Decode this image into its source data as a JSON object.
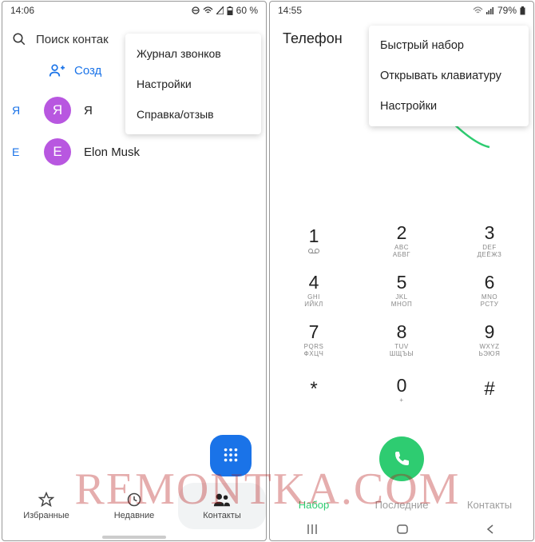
{
  "left": {
    "status": {
      "time": "14:06",
      "battery": "60 %"
    },
    "search_placeholder": "Поиск контак",
    "menu": {
      "item1": "Журнал звонков",
      "item2": "Настройки",
      "item3": "Справка/отзыв"
    },
    "create_label": "Созд",
    "contacts": [
      {
        "letter": "Я",
        "initial": "Я",
        "name": "Я",
        "color": "#b857e0"
      },
      {
        "letter": "E",
        "initial": "E",
        "name": "Elon Musk",
        "color": "#b857e0"
      }
    ],
    "bottom": {
      "fav": "Избранные",
      "recent": "Недавние",
      "contacts": "Контакты"
    }
  },
  "right": {
    "status": {
      "time": "14:55",
      "battery": "79%"
    },
    "header": "Телефон",
    "menu": {
      "item1": "Быстрый набор",
      "item2": "Открывать клавиатуру",
      "item3": "Настройки"
    },
    "keys": [
      {
        "n": "1",
        "s": ""
      },
      {
        "n": "2",
        "s": "ABC\nАБВГ"
      },
      {
        "n": "3",
        "s": "DEF\nДЕЁЖЗ"
      },
      {
        "n": "4",
        "s": "GHI\nИЙКЛ"
      },
      {
        "n": "5",
        "s": "JKL\nМНОП"
      },
      {
        "n": "6",
        "s": "MNO\nРСТУ"
      },
      {
        "n": "7",
        "s": "PQRS\nФХЦЧ"
      },
      {
        "n": "8",
        "s": "TUV\nШЩЪЫ"
      },
      {
        "n": "9",
        "s": "WXYZ\nЬЭЮЯ"
      },
      {
        "n": "*",
        "s": ""
      },
      {
        "n": "0",
        "s": "+"
      },
      {
        "n": "#",
        "s": ""
      }
    ],
    "bottom": {
      "dial": "Набор",
      "recent": "Последние",
      "contacts": "Контакты"
    }
  },
  "watermark": "REMONTKA.COM"
}
